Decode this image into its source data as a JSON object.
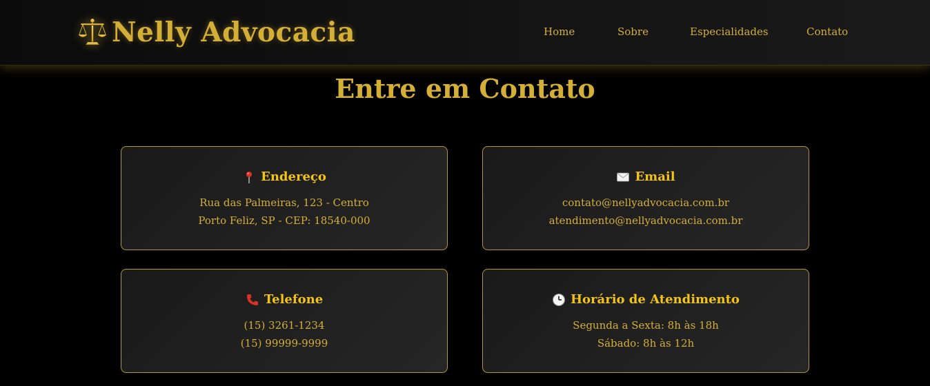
{
  "brand": {
    "name": "Nelly Advocacia",
    "icon": "scales-of-justice-icon"
  },
  "nav": {
    "items": [
      "Home",
      "Sobre",
      "Especialidades",
      "Contato"
    ]
  },
  "page": {
    "title": "Entre em Contato"
  },
  "cards": [
    {
      "icon": "pin-icon",
      "title": "Endereço",
      "lines": [
        "Rua das Palmeiras, 123 - Centro",
        "Porto Feliz, SP - CEP: 18540-000"
      ]
    },
    {
      "icon": "envelope-icon",
      "title": "Email",
      "lines": [
        "contato@nellyadvocacia.com.br",
        "atendimento@nellyadvocacia.com.br"
      ]
    },
    {
      "icon": "telephone-icon",
      "title": "Telefone",
      "lines": [
        "(15) 3261-1234",
        "(15) 99999-9999"
      ]
    },
    {
      "icon": "clock-icon",
      "title": "Horário de Atendimento",
      "lines": [
        "Segunda a Sexta: 8h às 18h",
        "Sábado: 8h às 12h"
      ]
    }
  ],
  "colors": {
    "gold": "#d4af37",
    "bright_gold": "#f2c416",
    "background": "#000000",
    "card_border": "#b8962e"
  }
}
